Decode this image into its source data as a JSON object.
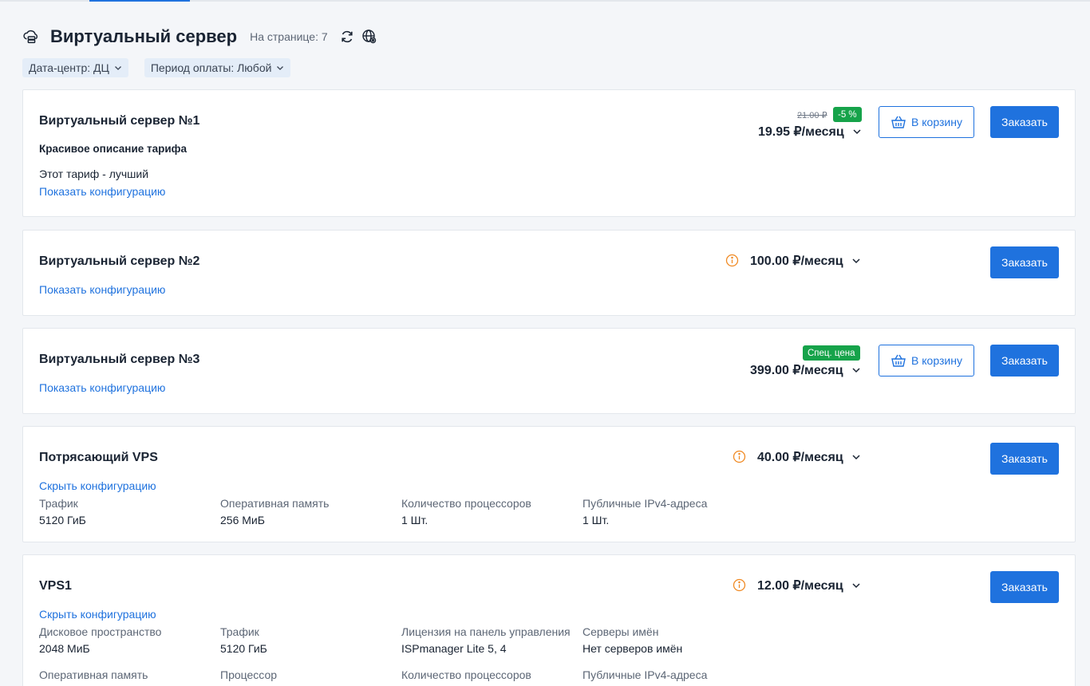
{
  "header": {
    "title": "Виртуальный сервер",
    "per_page": "На странице: 7"
  },
  "filters": [
    {
      "label": "Дата-центр: ДЦ"
    },
    {
      "label": "Период оплаты: Любой"
    }
  ],
  "colors": {
    "accent": "#1f72de",
    "badge": "#16a34a",
    "info": "#f08a24"
  },
  "cards": [
    {
      "title": "Виртуальный сервер №1",
      "subtitle": "Красивое описание тарифа",
      "description": "Этот тариф - лучший",
      "config_link": "Показать конфигурацию",
      "old_price": "21.00 ₽",
      "discount": "-5 %",
      "price": "19.95 ₽/месяц",
      "cart_label": "В корзину",
      "order_label": "Заказать"
    },
    {
      "title": "Виртуальный сервер №2",
      "config_link": "Показать конфигурацию",
      "price": "100.00 ₽/месяц",
      "order_label": "Заказать"
    },
    {
      "title": "Виртуальный сервер №3",
      "config_link": "Показать конфигурацию",
      "special": "Спец. цена",
      "price": "399.00 ₽/месяц",
      "cart_label": "В корзину",
      "order_label": "Заказать"
    },
    {
      "title": "Потрясающий VPS",
      "config_link": "Скрыть конфигурацию",
      "price": "40.00 ₽/месяц",
      "order_label": "Заказать",
      "specs": [
        {
          "label": "Трафик",
          "value": "5120 ГиБ"
        },
        {
          "label": "Оперативная память",
          "value": "256 МиБ"
        },
        {
          "label": "Количество процессоров",
          "value": "1 Шт."
        },
        {
          "label": "Публичные IPv4-адреса",
          "value": "1 Шт."
        }
      ]
    },
    {
      "title": "VPS1",
      "config_link": "Скрыть конфигурацию",
      "price": "12.00 ₽/месяц",
      "order_label": "Заказать",
      "specs": [
        {
          "label": "Дисковое пространство",
          "value": "2048 МиБ"
        },
        {
          "label": "Трафик",
          "value": "5120 ГиБ"
        },
        {
          "label": "Лицензия на панель управления",
          "value": "ISPmanager Lite 5, 4"
        },
        {
          "label": "Серверы имён",
          "value": "Нет серверов имён"
        },
        {
          "label": "Оперативная память",
          "value": ""
        },
        {
          "label": "Процессор",
          "value": ""
        },
        {
          "label": "Количество процессоров",
          "value": ""
        },
        {
          "label": "Публичные IPv4-адреса",
          "value": ""
        }
      ]
    }
  ]
}
